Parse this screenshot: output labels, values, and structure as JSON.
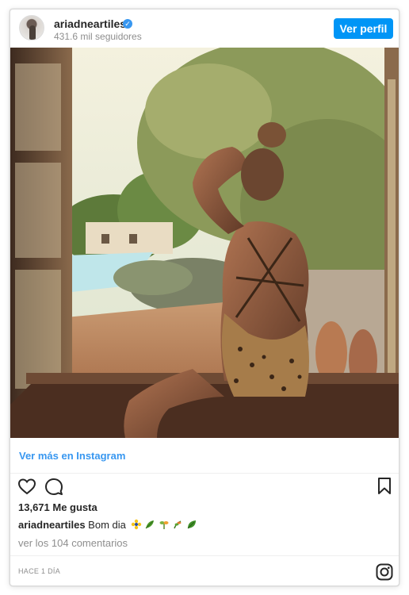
{
  "header": {
    "username": "ariadneartiles",
    "followers": "431.6 mil seguidores",
    "view_profile_label": "Ver perfil"
  },
  "post": {
    "image_icon": "photo-woman-at-window",
    "more_link": "Ver más en Instagram",
    "likes": "13,671 Me gusta",
    "caption_user": "ariadneartiles",
    "caption_text": "Bom dia",
    "caption_emojis": [
      "sparkle-flower-emoji",
      "leaves-emoji",
      "seedling-emoji",
      "herb-emoji",
      "leaf-emoji"
    ],
    "comments_link": "ver los 104 comentarios",
    "timestamp": "HACE 1 DÍA"
  },
  "icons": {
    "like": "heart-icon",
    "comment": "comment-icon",
    "save": "bookmark-icon",
    "brand": "instagram-icon",
    "verified": "verified-badge-icon"
  },
  "colors": {
    "accent": "#0095f6",
    "link": "#3897f0",
    "muted": "#8e8e8e",
    "verified": "#3897f0"
  }
}
